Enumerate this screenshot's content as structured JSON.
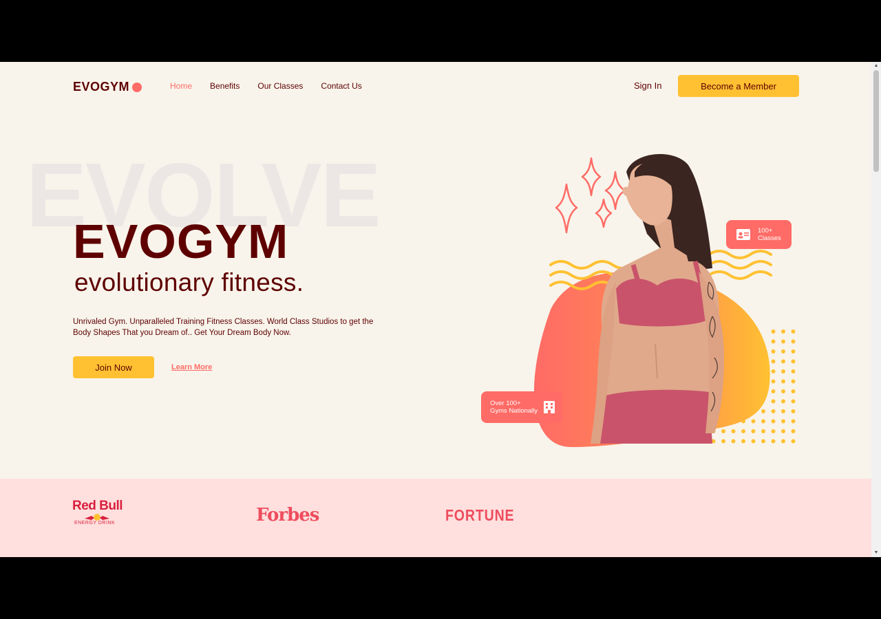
{
  "nav": {
    "logo": "EVOGYM",
    "links": [
      "Home",
      "Benefits",
      "Our Classes",
      "Contact Us"
    ],
    "active_index": 0,
    "sign_in": "Sign In",
    "member_button": "Become a Member"
  },
  "hero": {
    "background_word": "EVOLVE",
    "title": "EVOGYM",
    "subtitle": "evolutionary fitness.",
    "description": "Unrivaled Gym. Unparalleled Training Fitness Classes. World Class Studios to get the Body Shapes That you Dream of.. Get Your Dream Body Now.",
    "join_button": "Join Now",
    "learn_more": "Learn More",
    "badge_classes": {
      "line1": "100+",
      "line2": "Classes",
      "icon": "id-card-icon"
    },
    "badge_gyms": {
      "line1": "Over 100+",
      "line2": "Gyms Nationally",
      "icon": "building-icon"
    }
  },
  "sponsors": {
    "redbull": {
      "title": "Red Bull",
      "sub": "ENERGY DRINK"
    },
    "forbes": "Forbes",
    "fortune": "FORTUNE"
  },
  "colors": {
    "brand": "#5e0000",
    "accent": "#ff6b66",
    "yellow": "#ffc132",
    "background": "#f8f4eb",
    "sponsor_bg": "#ffe0de"
  }
}
